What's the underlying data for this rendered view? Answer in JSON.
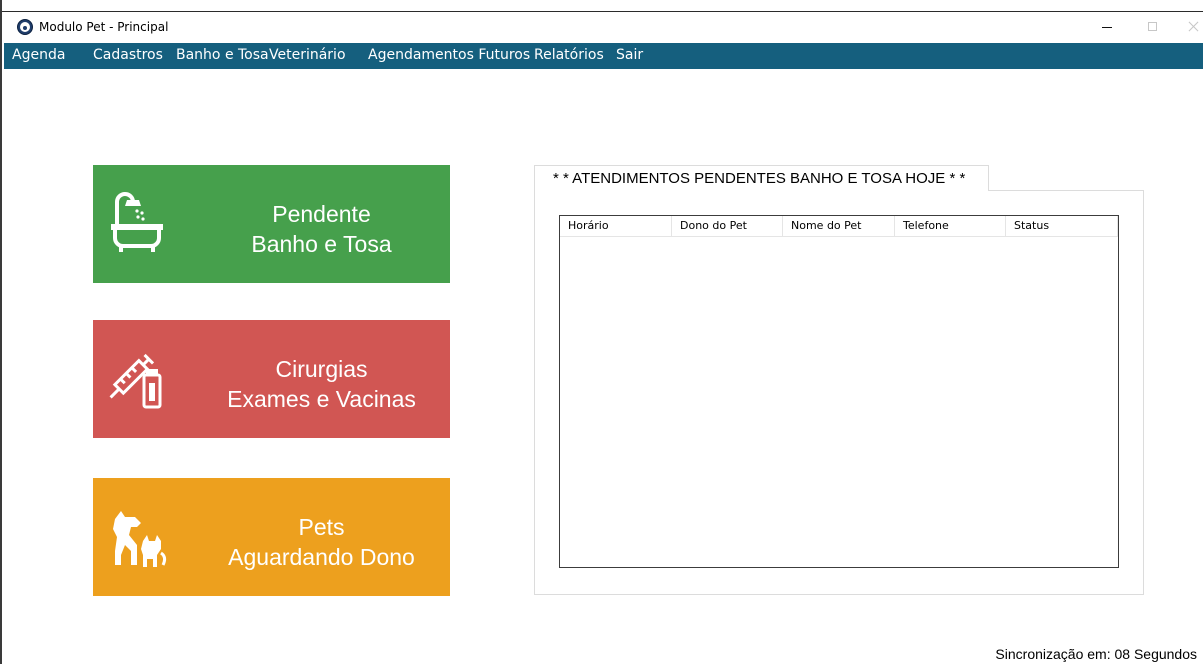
{
  "window": {
    "title": "Modulo Pet - Principal"
  },
  "menu": {
    "items": [
      "Agenda",
      "Cadastros",
      "Banho e Tosa",
      "Veterinário",
      "Agendamentos Futuros",
      "Relatórios",
      "Sair"
    ]
  },
  "tiles": {
    "bath": {
      "line1": "Pendente",
      "line2": "Banho e Tosa",
      "icon": "bathtub-icon",
      "color": "#46a04c"
    },
    "vet": {
      "line1": "Cirurgias",
      "line2": "Exames e Vacinas",
      "icon": "syringe-vial-icon",
      "color": "#d15653"
    },
    "pets": {
      "line1": "Pets",
      "line2": "Aguardando Dono",
      "icon": "dog-cat-icon",
      "color": "#eda01e"
    }
  },
  "pending": {
    "title": "* * ATENDIMENTOS PENDENTES BANHO E TOSA HOJE * *",
    "columns": [
      "Horário",
      "Dono do Pet",
      "Nome do Pet",
      "Telefone",
      "Status"
    ],
    "rows": []
  },
  "status": {
    "sync": "Sincronização em: 08 Segundos"
  },
  "colors": {
    "menubar": "#155f7e"
  }
}
